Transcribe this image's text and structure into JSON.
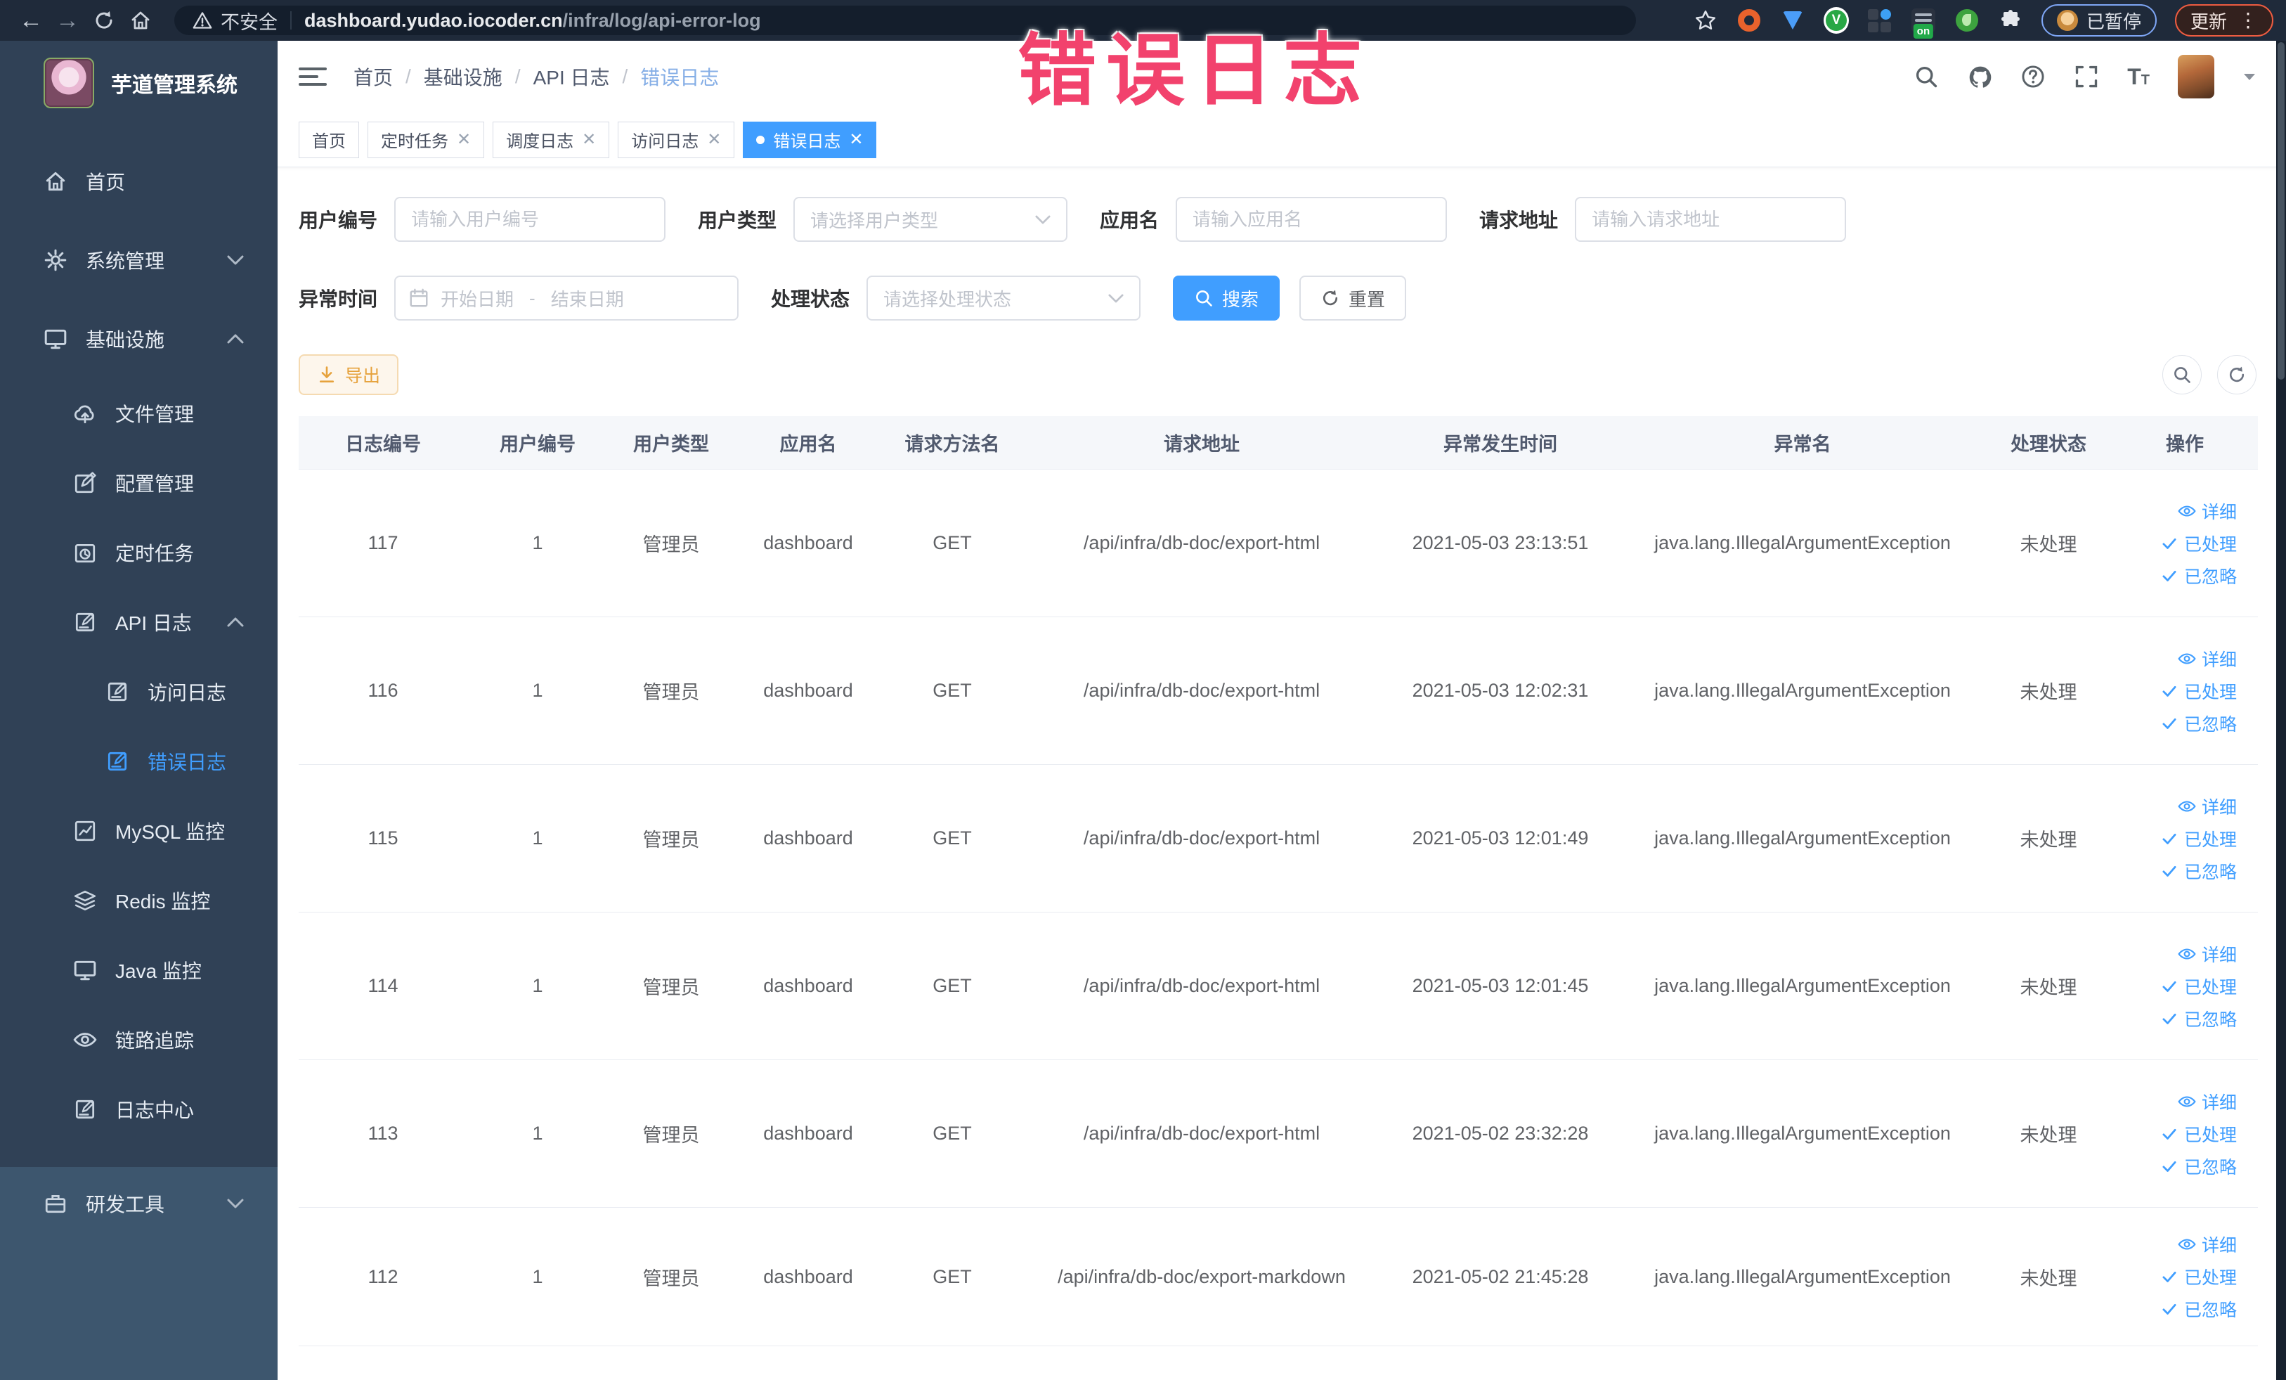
{
  "browser": {
    "security_text": "不安全",
    "url_domain": "dashboard.yudao.iocoder.cn",
    "url_path": "/infra/log/api-error-log",
    "ext_on_badge": "on",
    "paused_label": "已暂停",
    "update_label": "更新"
  },
  "annotation": {
    "text": "错误日志",
    "color": "#f2426d"
  },
  "app": {
    "title": "芋道管理系统"
  },
  "sidebar": {
    "items": [
      {
        "label": "首页"
      },
      {
        "label": "系统管理"
      },
      {
        "label": "基础设施"
      },
      {
        "label": "文件管理"
      },
      {
        "label": "配置管理"
      },
      {
        "label": "定时任务"
      },
      {
        "label": "API 日志"
      },
      {
        "label": "访问日志"
      },
      {
        "label": "错误日志"
      },
      {
        "label": "MySQL 监控"
      },
      {
        "label": "Redis 监控"
      },
      {
        "label": "Java 监控"
      },
      {
        "label": "链路追踪"
      },
      {
        "label": "日志中心"
      },
      {
        "label": "研发工具"
      }
    ]
  },
  "breadcrumb": {
    "items": [
      "首页",
      "基础设施",
      "API 日志",
      "错误日志"
    ]
  },
  "tags": {
    "items": [
      {
        "label": "首页"
      },
      {
        "label": "定时任务"
      },
      {
        "label": "调度日志"
      },
      {
        "label": "访问日志"
      },
      {
        "label": "错误日志"
      }
    ]
  },
  "search": {
    "user_id": {
      "label": "用户编号",
      "placeholder": "请输入用户编号"
    },
    "user_type": {
      "label": "用户类型",
      "placeholder": "请选择用户类型"
    },
    "app_name": {
      "label": "应用名",
      "placeholder": "请输入应用名"
    },
    "request_url": {
      "label": "请求地址",
      "placeholder": "请输入请求地址"
    },
    "exception_time": {
      "label": "异常时间",
      "start_placeholder": "开始日期",
      "separator": "-",
      "end_placeholder": "结束日期"
    },
    "process_status": {
      "label": "处理状态",
      "placeholder": "请选择处理状态"
    },
    "search_label": "搜索",
    "reset_label": "重置"
  },
  "toolbar": {
    "export_label": "导出"
  },
  "table": {
    "headers": [
      "日志编号",
      "用户编号",
      "用户类型",
      "应用名",
      "请求方法名",
      "请求地址",
      "异常发生时间",
      "异常名",
      "处理状态",
      "操作"
    ],
    "actions": [
      "详细",
      "已处理",
      "已忽略"
    ],
    "rows": [
      {
        "id": "117",
        "user_id": "1",
        "user_type": "管理员",
        "app_name": "dashboard",
        "method": "GET",
        "url": "/api/infra/db-doc/export-html",
        "time": "2021-05-03 23:13:51",
        "exception": "java.lang.IllegalArgumentException",
        "status": "未处理"
      },
      {
        "id": "116",
        "user_id": "1",
        "user_type": "管理员",
        "app_name": "dashboard",
        "method": "GET",
        "url": "/api/infra/db-doc/export-html",
        "time": "2021-05-03 12:02:31",
        "exception": "java.lang.IllegalArgumentException",
        "status": "未处理"
      },
      {
        "id": "115",
        "user_id": "1",
        "user_type": "管理员",
        "app_name": "dashboard",
        "method": "GET",
        "url": "/api/infra/db-doc/export-html",
        "time": "2021-05-03 12:01:49",
        "exception": "java.lang.IllegalArgumentException",
        "status": "未处理"
      },
      {
        "id": "114",
        "user_id": "1",
        "user_type": "管理员",
        "app_name": "dashboard",
        "method": "GET",
        "url": "/api/infra/db-doc/export-html",
        "time": "2021-05-03 12:01:45",
        "exception": "java.lang.IllegalArgumentException",
        "status": "未处理"
      },
      {
        "id": "113",
        "user_id": "1",
        "user_type": "管理员",
        "app_name": "dashboard",
        "method": "GET",
        "url": "/api/infra/db-doc/export-html",
        "time": "2021-05-02 23:32:28",
        "exception": "java.lang.IllegalArgumentException",
        "status": "未处理"
      },
      {
        "id": "112",
        "user_id": "1",
        "user_type": "管理员",
        "app_name": "dashboard",
        "method": "GET",
        "url": "/api/infra/db-doc/export-markdown",
        "time": "2021-05-02 21:45:28",
        "exception": "java.lang.IllegalArgumentException",
        "status": "未处理"
      }
    ]
  },
  "colors": {
    "accent": "#409eff",
    "sidebar_bg": "#304156",
    "warning": "#e6a23c",
    "annotation_pink": "#f2426d"
  }
}
